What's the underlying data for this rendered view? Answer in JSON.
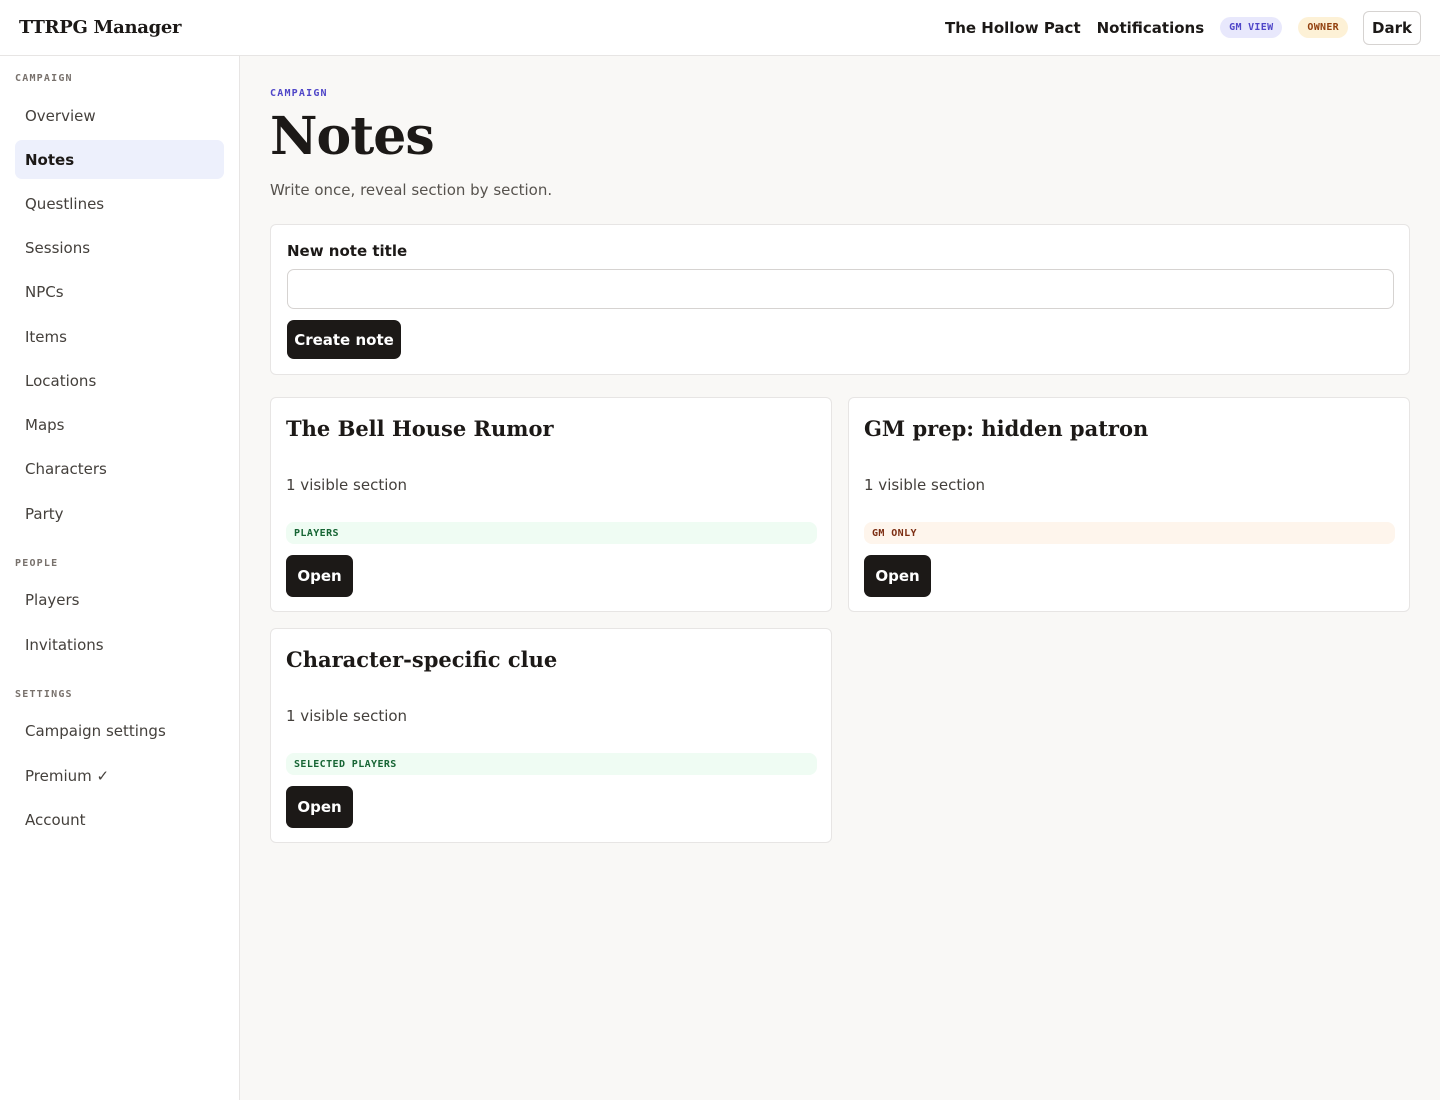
{
  "app": {
    "title": "TTRPG Manager"
  },
  "topbar": {
    "campaign_name": "The Hollow Pact",
    "notifications_label": "Notifications",
    "gm_view_badge": "GM VIEW",
    "owner_badge": "OWNER",
    "theme_toggle_label": "Dark"
  },
  "sidebar": {
    "sections": [
      {
        "label": "CAMPAIGN",
        "items": [
          {
            "label": "Overview"
          },
          {
            "label": "Notes",
            "active": true
          },
          {
            "label": "Questlines"
          },
          {
            "label": "Sessions"
          },
          {
            "label": "NPCs"
          },
          {
            "label": "Items"
          },
          {
            "label": "Locations"
          },
          {
            "label": "Maps"
          },
          {
            "label": "Characters"
          },
          {
            "label": "Party"
          }
        ]
      },
      {
        "label": "PEOPLE",
        "items": [
          {
            "label": "Players"
          },
          {
            "label": "Invitations"
          }
        ]
      },
      {
        "label": "SETTINGS",
        "items": [
          {
            "label": "Campaign settings"
          },
          {
            "label": "Premium ✓"
          },
          {
            "label": "Account"
          }
        ]
      }
    ]
  },
  "page": {
    "eyebrow": "CAMPAIGN",
    "title": "Notes",
    "subtitle": "Write once, reveal section by section."
  },
  "new_note": {
    "label": "New note title",
    "value": "",
    "placeholder": "",
    "create_label": "Create note"
  },
  "notes": [
    {
      "title": "The Bell House Rumor",
      "meta": "1 visible section",
      "visibility": "PLAYERS",
      "visibility_tone": "green",
      "open_label": "Open"
    },
    {
      "title": "GM prep: hidden patron",
      "meta": "1 visible section",
      "visibility": "GM ONLY",
      "visibility_tone": "orange",
      "open_label": "Open"
    },
    {
      "title": "Character-specific clue",
      "meta": "1 visible section",
      "visibility": "SELECTED PLAYERS",
      "visibility_tone": "green",
      "open_label": "Open"
    }
  ],
  "colors": {
    "accent": "#4f46c8",
    "primary_button": "#1c1917",
    "active_nav_bg": "#edf0fc",
    "players_badge_bg": "#effcf3",
    "gm_only_badge_bg": "#fef5ec"
  }
}
